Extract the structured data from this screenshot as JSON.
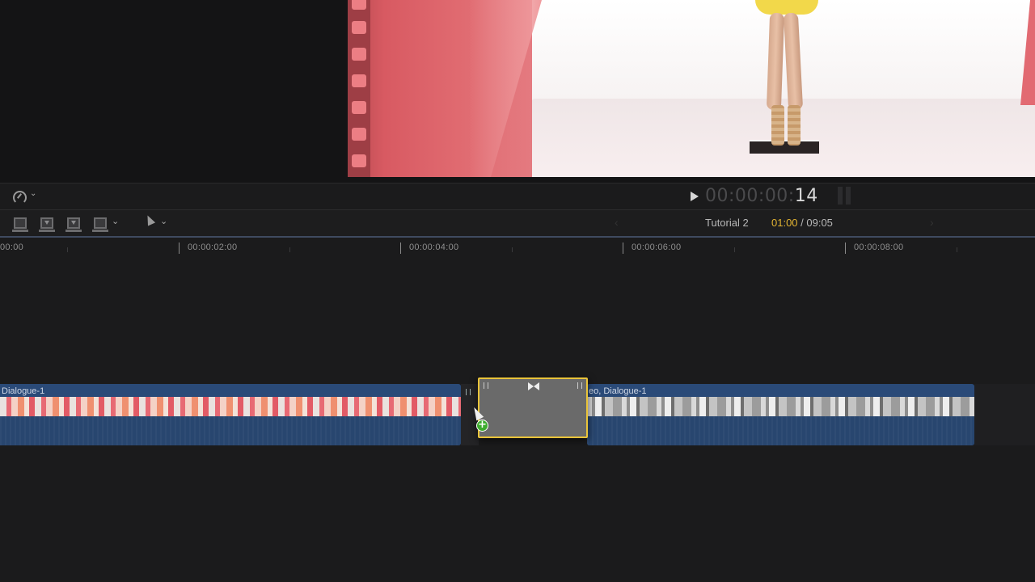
{
  "transport": {
    "timecode_dim": "00:00:00:",
    "timecode_frames": "14"
  },
  "toolbar": {
    "project_name": "Tutorial 2",
    "duration_current": "01:00",
    "duration_total": " / 09:05"
  },
  "ruler": {
    "labels": [
      "00:00",
      "00:00:02:00",
      "00:00:04:00",
      "00:00:06:00",
      "00:00:08:00"
    ]
  },
  "timeline": {
    "clip_left": {
      "name": "Dialogue-1"
    },
    "clip_right": {
      "name": "eo, Dialogue-1"
    }
  },
  "icons": {
    "speed": "speedometer-icon",
    "select": "arrow-tool-icon",
    "play": "play-icon",
    "transition": "cross-dissolve-icon",
    "cursor_badge": "plus-icon"
  },
  "colors": {
    "accent_yellow": "#e9c43a",
    "clip_blue": "#2a4a78",
    "timecode_gold": "#e3b432",
    "add_green": "#3dac2e"
  }
}
